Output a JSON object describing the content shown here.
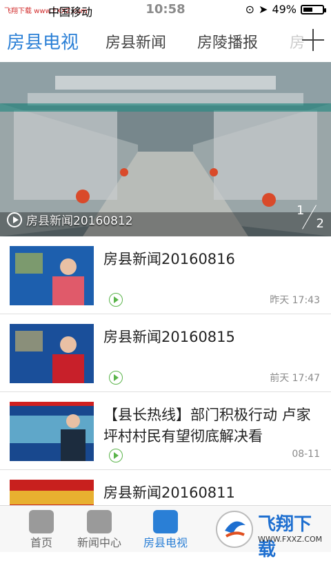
{
  "status": {
    "watermark": "飞翔下载 www.FXXZ.com",
    "carrier": "中国移动",
    "time": "10:58",
    "battery": "49%",
    "battery_level": 0.49
  },
  "tabs": [
    {
      "label": "房县电视"
    },
    {
      "label": "房县新闻"
    },
    {
      "label": "房陵播报"
    },
    {
      "label": "房"
    }
  ],
  "hero": {
    "caption": "房县新闻20160812",
    "page_current": "1",
    "page_total": "2"
  },
  "news": [
    {
      "title": "房县新闻20160816",
      "time": "昨天 17:43"
    },
    {
      "title": "房县新闻20160815",
      "time": "前天 17:47"
    },
    {
      "title": "【县长热线】部门积极行动 卢家坪村村民有望彻底解决看",
      "time": "08-11"
    },
    {
      "title": "房县新闻20160811",
      "time": ""
    }
  ],
  "bottom_nav": [
    {
      "label": "首页"
    },
    {
      "label": "新闻中心"
    },
    {
      "label": "房县电视"
    }
  ],
  "watermark_logo": {
    "title": "飞翔下载",
    "url": "WWW.FXXZ.COM"
  },
  "colors": {
    "accent": "#2a7fd6",
    "play_green": "#5ab44a"
  }
}
